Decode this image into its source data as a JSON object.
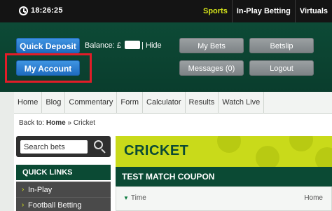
{
  "topbar": {
    "time": "18:26:25",
    "nav": [
      "Sports",
      "In-Play Betting",
      "Virtuals"
    ]
  },
  "account": {
    "quick_deposit": "Quick Deposit",
    "my_account": "My Account",
    "balance_label": "Balance: £",
    "balance_separator": "|",
    "hide": "Hide",
    "my_bets": "My Bets",
    "betslip": "Betslip",
    "messages": "Messages (0)",
    "logout": "Logout"
  },
  "mainnav": [
    "Home",
    "Blog",
    "Commentary",
    "Form",
    "Calculator",
    "Results",
    "Watch Live"
  ],
  "breadcrumb": {
    "prefix": "Back to: ",
    "home": "Home",
    "separator": " » ",
    "current": "Cricket"
  },
  "search": {
    "placeholder": "Search bets"
  },
  "quick_links": {
    "title": "QUICK LINKS",
    "items": [
      "In-Play",
      "Football Betting"
    ]
  },
  "content": {
    "banner_title": "CRICKET",
    "coupon_title": "TEST MATCH COUPON",
    "col_time": "Time",
    "col_home": "Home"
  },
  "colors": {
    "dark_green": "#0b4a34",
    "lime": "#c9da1a",
    "blue_button": "#2a7bd0",
    "highlight_red": "#e21d28"
  }
}
